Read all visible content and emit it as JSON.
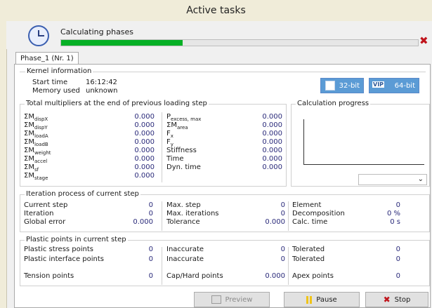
{
  "window": {
    "title": "Active tasks"
  },
  "status": {
    "phase_label": "Calculating phases",
    "progress_fraction": 0.34
  },
  "tabs": [
    {
      "label": "Phase_1 (Nr. 1)"
    }
  ],
  "kernel": {
    "title": "Kernel information",
    "start_time_label": "Start time",
    "start_time_value": "16:12:42",
    "memory_label": "Memory used",
    "memory_value": "unknown",
    "bit32_label": "32-bit",
    "bit64_label": "64-bit",
    "vip_label": "VIP"
  },
  "multipliers": {
    "title": "Total multipliers at the end of previous loading step",
    "left": [
      {
        "sym": "ΣM",
        "sub": "dispX",
        "value": "0.000"
      },
      {
        "sym": "ΣM",
        "sub": "dispY",
        "value": "0.000"
      },
      {
        "sym": "ΣM",
        "sub": "loadA",
        "value": "0.000"
      },
      {
        "sym": "ΣM",
        "sub": "loadB",
        "value": "0.000"
      },
      {
        "sym": "ΣM",
        "sub": "weight",
        "value": "0.000"
      },
      {
        "sym": "ΣM",
        "sub": "accel",
        "value": "0.000"
      },
      {
        "sym": "ΣM",
        "sub": "sf",
        "value": "0.000"
      },
      {
        "sym": "ΣM",
        "sub": "stage",
        "value": "0.000"
      }
    ],
    "right": [
      {
        "sym": "P",
        "sub": "excess, max",
        "value": "0.000"
      },
      {
        "sym": "ΣM",
        "sub": "area",
        "value": "0.000"
      },
      {
        "sym": "F",
        "sub": "x",
        "value": "0.000"
      },
      {
        "sym": "F",
        "sub": "y",
        "value": "0.000"
      },
      {
        "sym": "Stiffness",
        "sub": "",
        "value": "0.000"
      },
      {
        "sym": "Time",
        "sub": "",
        "value": "0.000"
      },
      {
        "sym": "Dyn. time",
        "sub": "",
        "value": "0.000"
      }
    ]
  },
  "calc_progress": {
    "title": "Calculation progress"
  },
  "iteration": {
    "title": "Iteration process of current step",
    "rows": [
      [
        "Current step",
        "0",
        "Max. step",
        "0",
        "Element",
        "0"
      ],
      [
        "Iteration",
        "0",
        "Max. iterations",
        "0",
        "Decomposition",
        "0 %"
      ],
      [
        "Global error",
        "0.000",
        "Tolerance",
        "0.000",
        "Calc. time",
        "0 s"
      ]
    ]
  },
  "plastic": {
    "title": "Plastic points in current step",
    "rows": [
      [
        "Plastic stress points",
        "0",
        "Inaccurate",
        "0",
        "Tolerated",
        "0"
      ],
      [
        "Plastic interface points",
        "0",
        "Inaccurate",
        "0",
        "Tolerated",
        "0"
      ],
      [
        "Tension points",
        "0",
        "Cap/Hard points",
        "0.000",
        "Apex points",
        "0"
      ]
    ]
  },
  "buttons": {
    "preview": "Preview",
    "pause": "Pause",
    "stop": "Stop"
  },
  "colors": {
    "progress": "#06b025",
    "accent": "#5b9bd5",
    "stop": "#c0141c",
    "pause": "#f0c419"
  }
}
